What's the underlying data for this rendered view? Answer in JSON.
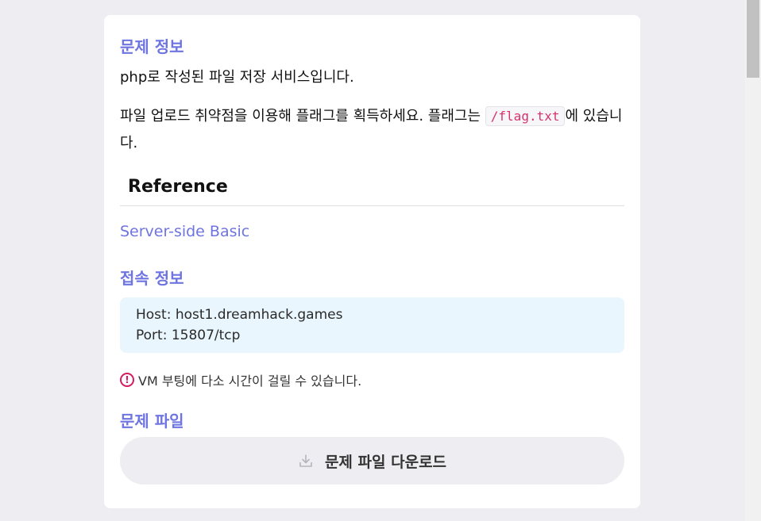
{
  "problem_info": {
    "title": "문제 정보",
    "line1": "php로 작성된 파일 저장 서비스입니다.",
    "line2_before": "파일 업로드 취약점을 이용해 플래그를 획득하세요. 플래그는 ",
    "line2_code": "/flag.txt",
    "line2_after": "에 있습니다."
  },
  "reference": {
    "heading": "Reference",
    "link": "Server-side Basic"
  },
  "connection": {
    "title": "접속 정보",
    "host": "Host: host1.dreamhack.games",
    "port": "Port: 15807/tcp",
    "notice": "VM 부팅에 다소 시간이 걸릴 수 있습니다.",
    "notice_icon": "exclamation-circle-icon"
  },
  "files": {
    "title": "문제 파일",
    "download_label": "문제 파일 다운로드",
    "download_icon": "download-icon"
  },
  "colors": {
    "accent": "#6e74e0",
    "code": "#d6336c",
    "alert": "#d81b60",
    "info_bg": "#e9f6fd"
  }
}
